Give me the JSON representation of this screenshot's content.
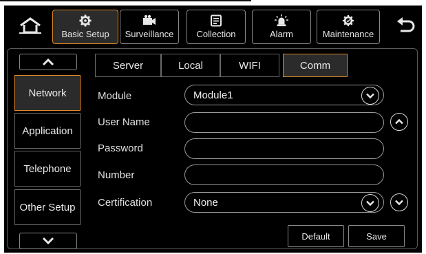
{
  "top_tabs": [
    {
      "label": "Basic Setup",
      "icon": "gear-icon",
      "active": true
    },
    {
      "label": "Surveillance",
      "icon": "camera-icon",
      "active": false
    },
    {
      "label": "Collection",
      "icon": "document-icon",
      "active": false
    },
    {
      "label": "Alarm",
      "icon": "alarm-light-icon",
      "active": false
    },
    {
      "label": "Maintenance",
      "icon": "maintenance-gear-icon",
      "active": false
    }
  ],
  "sidebar": {
    "items": [
      {
        "label": "Network",
        "active": true
      },
      {
        "label": "Application",
        "active": false
      },
      {
        "label": "Telephone",
        "active": false
      },
      {
        "label": "Other Setup",
        "active": false
      }
    ]
  },
  "sub_tabs": [
    {
      "label": "Server",
      "active": false
    },
    {
      "label": "Local",
      "active": false
    },
    {
      "label": "WIFI",
      "active": false
    },
    {
      "label": "Comm",
      "active": true
    }
  ],
  "form": {
    "module_label": "Module",
    "module_value": "Module1",
    "username_label": "User Name",
    "username_value": "",
    "password_label": "Password",
    "password_value": "",
    "number_label": "Number",
    "number_value": "",
    "certification_label": "Certification",
    "certification_value": "None"
  },
  "buttons": {
    "default_label": "Default",
    "save_label": "Save"
  },
  "colors": {
    "background": "#000000",
    "active_border": "#e38a2a",
    "active_fill": "#2b2b2b",
    "text": "#e8e8e8"
  }
}
